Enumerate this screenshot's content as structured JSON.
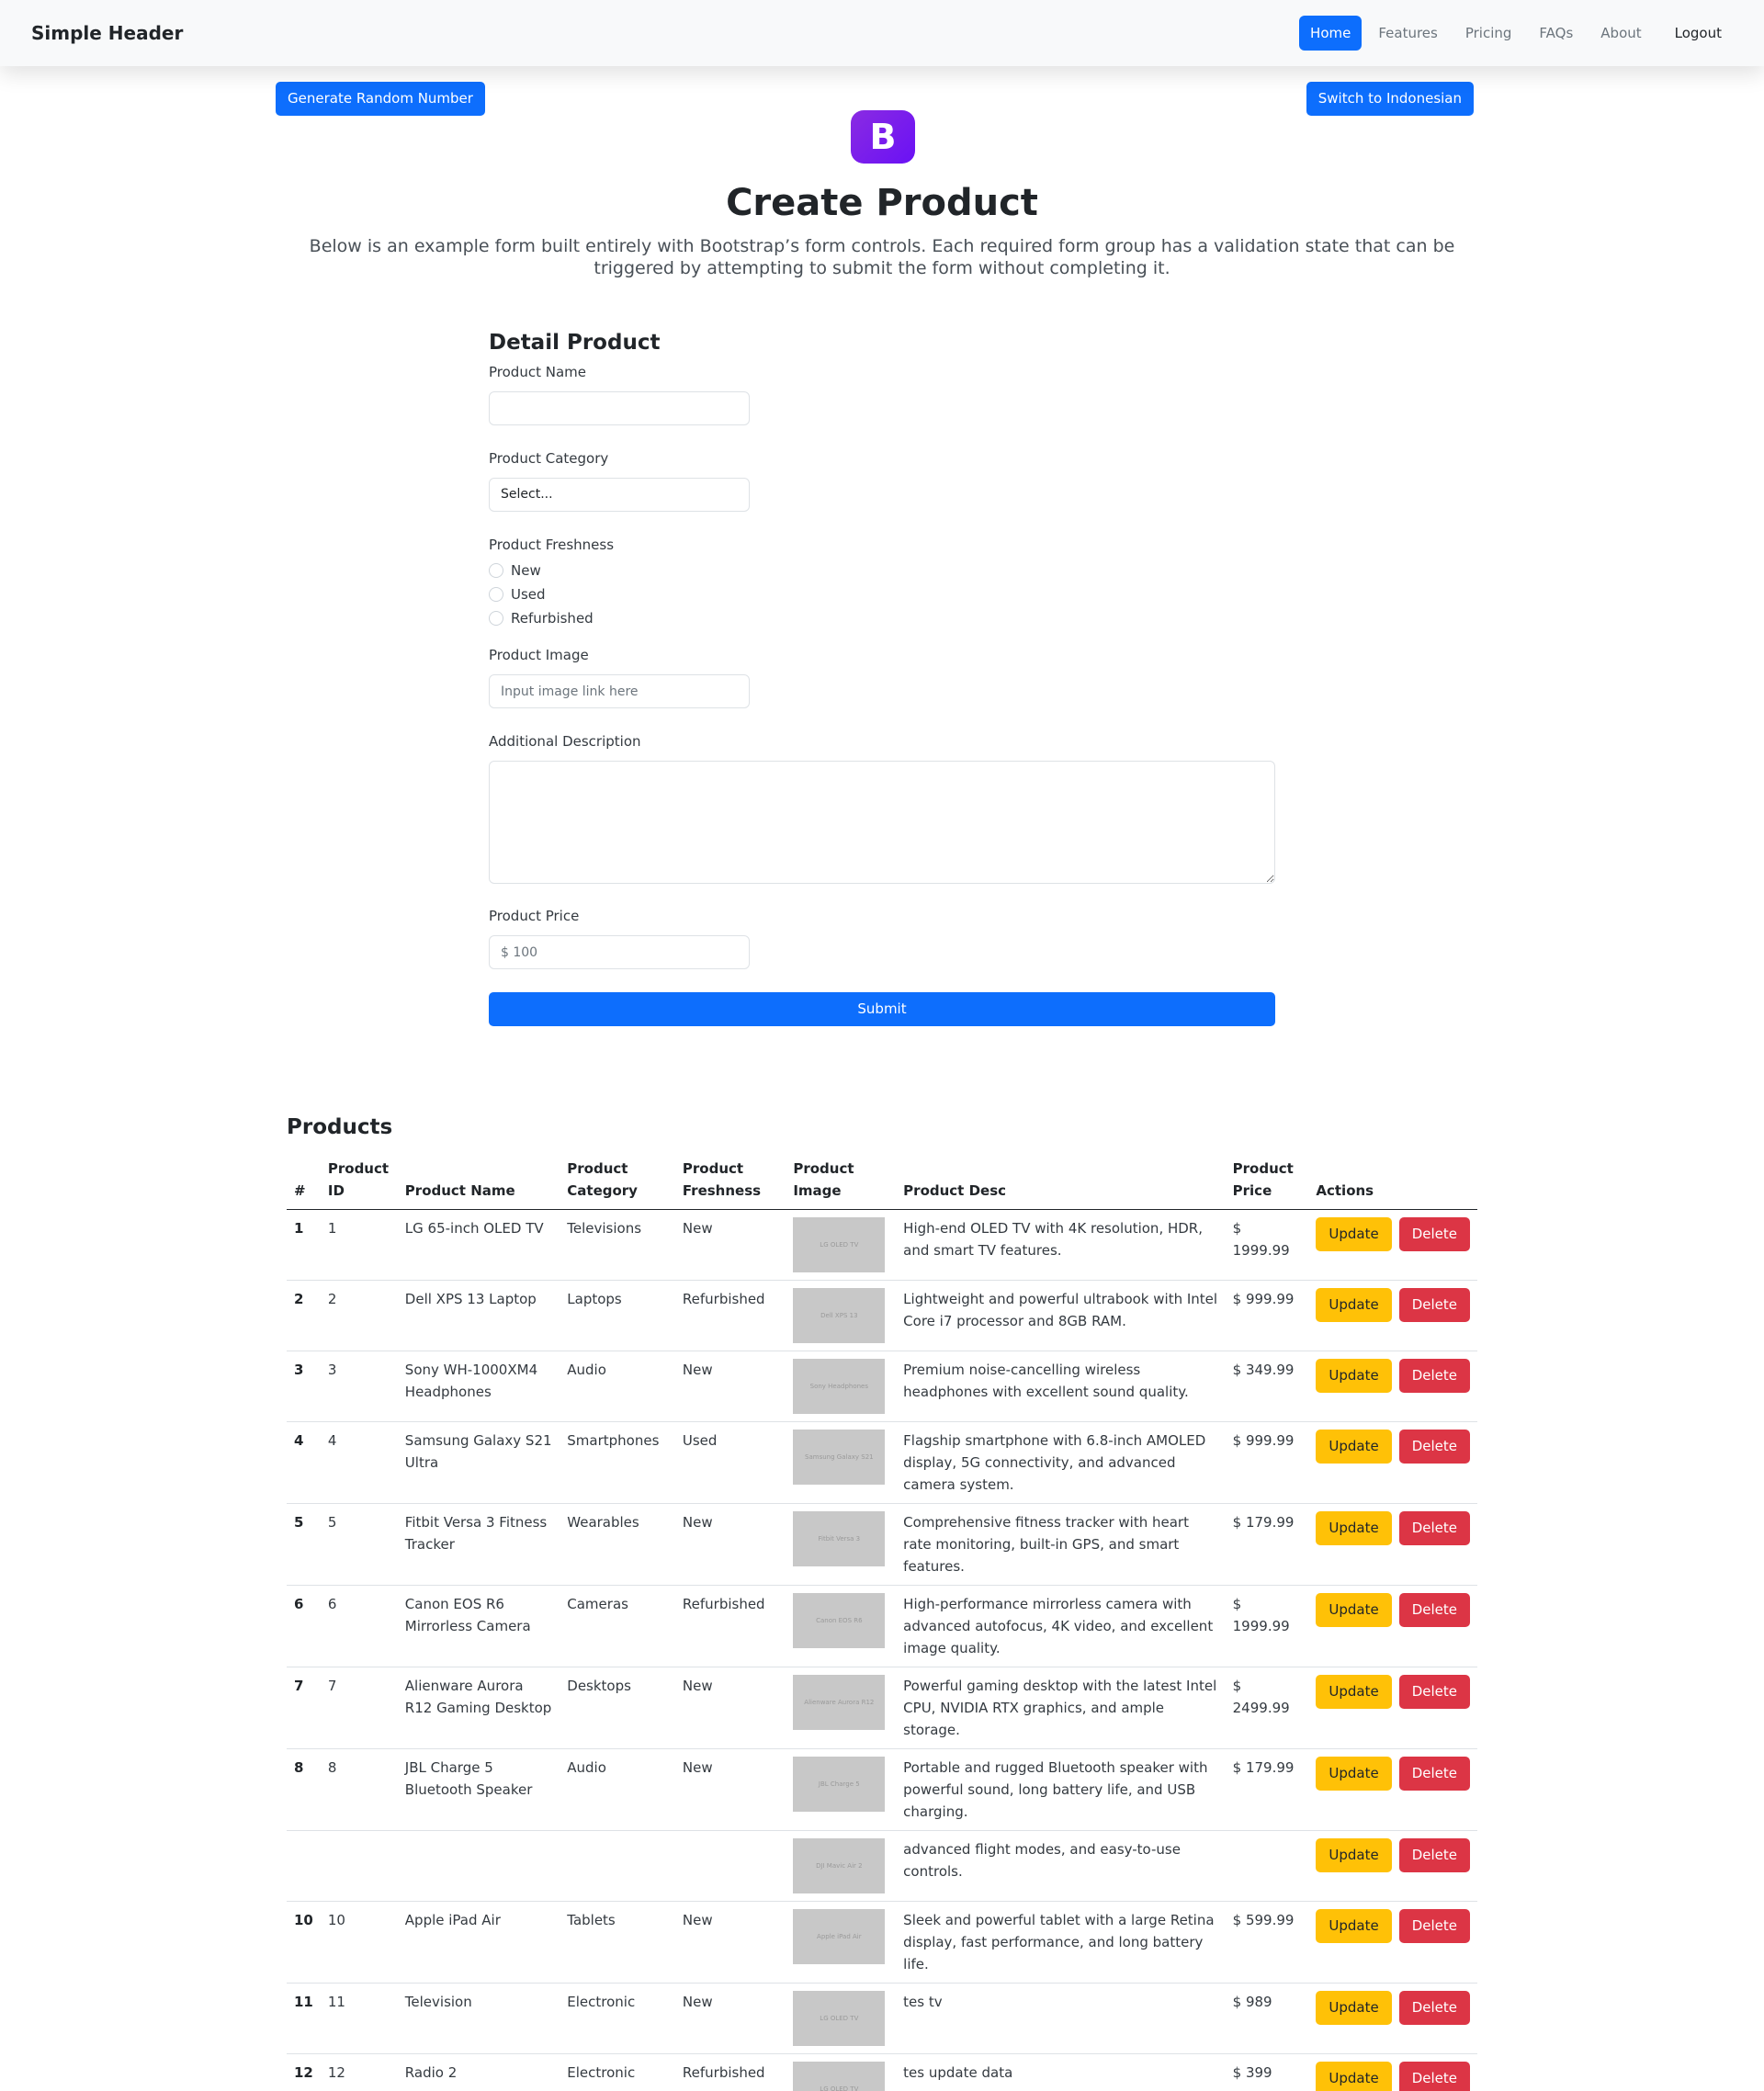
{
  "header": {
    "brand": "Simple Header",
    "nav": [
      "Home",
      "Features",
      "Pricing",
      "FAQs",
      "About"
    ],
    "logout": "Logout"
  },
  "buttons": {
    "generate": "Generate Random Number",
    "language": "Switch to Indonesian"
  },
  "logo_letter": "B",
  "page": {
    "title": "Create Product",
    "lead": "Below is an example form built entirely with Bootstrap’s form controls. Each required form group has a validation state that can be triggered by attempting to submit the form without completing it."
  },
  "form": {
    "heading": "Detail Product",
    "product_name_label": "Product Name",
    "product_name_value": "",
    "category_label": "Product Category",
    "category_selected": "Select...",
    "freshness_label": "Product Freshness",
    "freshness_options": [
      "New",
      "Used",
      "Refurbished"
    ],
    "image_label": "Product Image",
    "image_placeholder": "Input image link here",
    "desc_label": "Additional Description",
    "price_label": "Product Price",
    "price_placeholder": "$ 100",
    "submit": "Submit"
  },
  "products": {
    "title": "Products",
    "columns": [
      "#",
      "Product ID",
      "Product Name",
      "Product Category",
      "Product Freshness",
      "Product Image",
      "Product Desc",
      "Product Price",
      "Actions"
    ],
    "update_label": "Update",
    "delete_label": "Delete",
    "rows": [
      {
        "no": "1",
        "id": "1",
        "name": "LG 65-inch OLED TV",
        "category": "Televisions",
        "freshness": "New",
        "image_text": "LG OLED TV",
        "desc": "High-end OLED TV with 4K resolution, HDR, and smart TV features.",
        "price": "$ 1999.99"
      },
      {
        "no": "2",
        "id": "2",
        "name": "Dell XPS 13 Laptop",
        "category": "Laptops",
        "freshness": "Refurbished",
        "image_text": "Dell XPS 13",
        "desc": "Lightweight and powerful ultrabook with Intel Core i7 processor and 8GB RAM.",
        "price": "$ 999.99"
      },
      {
        "no": "3",
        "id": "3",
        "name": "Sony WH-1000XM4 Headphones",
        "category": "Audio",
        "freshness": "New",
        "image_text": "Sony Headphones",
        "desc": "Premium noise-cancelling wireless headphones with excellent sound quality.",
        "price": "$ 349.99"
      },
      {
        "no": "4",
        "id": "4",
        "name": "Samsung Galaxy S21 Ultra",
        "category": "Smartphones",
        "freshness": "Used",
        "image_text": "Samsung Galaxy S21",
        "desc": "Flagship smartphone with 6.8-inch AMOLED display, 5G connectivity, and advanced camera system.",
        "price": "$ 999.99"
      },
      {
        "no": "5",
        "id": "5",
        "name": "Fitbit Versa 3 Fitness Tracker",
        "category": "Wearables",
        "freshness": "New",
        "image_text": "Fitbit Versa 3",
        "desc": "Comprehensive fitness tracker with heart rate monitoring, built-in GPS, and smart features.",
        "price": "$ 179.99"
      },
      {
        "no": "6",
        "id": "6",
        "name": "Canon EOS R6 Mirrorless Camera",
        "category": "Cameras",
        "freshness": "Refurbished",
        "image_text": "Canon EOS R6",
        "desc": "High-performance mirrorless camera with advanced autofocus, 4K video, and excellent image quality.",
        "price": "$ 1999.99"
      },
      {
        "no": "7",
        "id": "7",
        "name": "Alienware Aurora R12 Gaming Desktop",
        "category": "Desktops",
        "freshness": "New",
        "image_text": "Alienware Aurora R12",
        "desc": "Powerful gaming desktop with the latest Intel CPU, NVIDIA RTX graphics, and ample storage.",
        "price": "$ 2499.99"
      },
      {
        "no": "8",
        "id": "8",
        "name": "JBL Charge 5 Bluetooth Speaker",
        "category": "Audio",
        "freshness": "New",
        "image_text": "JBL Charge 5",
        "desc": "Portable and rugged Bluetooth speaker with powerful sound, long battery life, and USB charging.",
        "price": "$ 179.99"
      },
      {
        "no": "",
        "id": "",
        "name": "",
        "category": "",
        "freshness": "",
        "image_text": "DJI Mavic Air 2",
        "desc": "advanced flight modes, and easy-to-use controls.",
        "price": ""
      },
      {
        "no": "10",
        "id": "10",
        "name": "Apple iPad Air",
        "category": "Tablets",
        "freshness": "New",
        "image_text": "Apple iPad Air",
        "desc": "Sleek and powerful tablet with a large Retina display, fast performance, and long battery life.",
        "price": "$ 599.99"
      },
      {
        "no": "11",
        "id": "11",
        "name": "Television",
        "category": "Electronic",
        "freshness": "New",
        "image_text": "LG OLED TV",
        "desc": "tes tv",
        "price": "$ 989"
      },
      {
        "no": "12",
        "id": "12",
        "name": "Radio 2",
        "category": "Electronic",
        "freshness": "Refurbished",
        "image_text": "LG OLED TV",
        "desc": "tes update data",
        "price": "$ 399"
      }
    ]
  }
}
